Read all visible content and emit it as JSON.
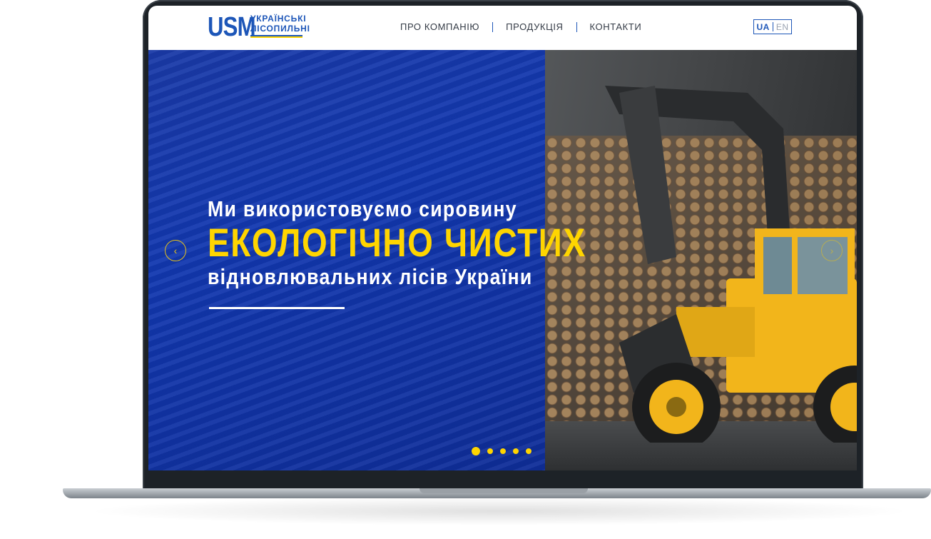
{
  "brand": {
    "logo_mark": "USM",
    "logo_line1": "УКРАЇНСЬКІ",
    "logo_line2": "ЛІСОПИЛЬНІ",
    "blue": "#1d56b8",
    "yellow": "#ffd500"
  },
  "nav": {
    "items": [
      {
        "label": "ПРО КОМПАНІЮ"
      },
      {
        "label": "ПРОДУКЦІЯ"
      },
      {
        "label": "КОНТАКТИ"
      }
    ]
  },
  "lang": {
    "ua": "UA",
    "en": "EN",
    "active": "UA"
  },
  "hero": {
    "line1": "Ми використовуємо сировину",
    "line2": "ЕКОЛОГІЧНО ЧИСТИХ",
    "line3": "відновлювальних лісів України",
    "prev_icon": "chevron-left-icon",
    "next_icon": "chevron-right-icon",
    "slides_count": 5,
    "active_slide": 1
  }
}
